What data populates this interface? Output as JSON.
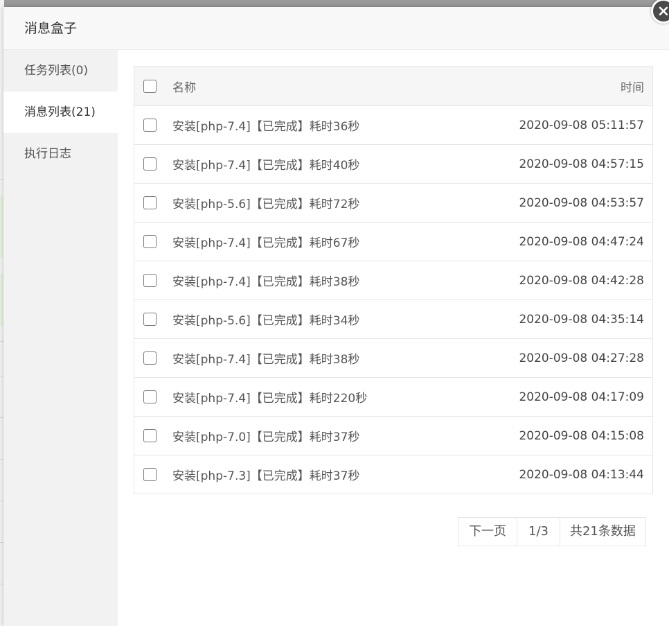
{
  "dialog": {
    "title": "消息盒子"
  },
  "sidebar": {
    "items": [
      {
        "label": "任务列表(0)"
      },
      {
        "label": "消息列表(21)"
      },
      {
        "label": "执行日志"
      }
    ],
    "active_index": 1
  },
  "table": {
    "columns": {
      "name": "名称",
      "time": "时间"
    },
    "rows": [
      {
        "name": "安装[php-7.4]【已完成】耗时36秒",
        "time": "2020-09-08 05:11:57"
      },
      {
        "name": "安装[php-7.4]【已完成】耗时40秒",
        "time": "2020-09-08 04:57:15"
      },
      {
        "name": "安装[php-5.6]【已完成】耗时72秒",
        "time": "2020-09-08 04:53:57"
      },
      {
        "name": "安装[php-7.4]【已完成】耗时67秒",
        "time": "2020-09-08 04:47:24"
      },
      {
        "name": "安装[php-7.4]【已完成】耗时38秒",
        "time": "2020-09-08 04:42:28"
      },
      {
        "name": "安装[php-5.6]【已完成】耗时34秒",
        "time": "2020-09-08 04:35:14"
      },
      {
        "name": "安装[php-7.4]【已完成】耗时38秒",
        "time": "2020-09-08 04:27:28"
      },
      {
        "name": "安装[php-7.4]【已完成】耗时220秒",
        "time": "2020-09-08 04:17:09"
      },
      {
        "name": "安装[php-7.0]【已完成】耗时37秒",
        "time": "2020-09-08 04:15:08"
      },
      {
        "name": "安装[php-7.3]【已完成】耗时37秒",
        "time": "2020-09-08 04:13:44"
      }
    ]
  },
  "pager": {
    "next_label": "下一页",
    "page_indicator": "1/3",
    "total_label": "共21条数据"
  },
  "icons": {
    "close": "close-icon"
  },
  "colors": {
    "sidebar_bg": "#f2f2f2",
    "header_bg": "#f8f8f8",
    "close_bg": "#4a4a4a"
  }
}
